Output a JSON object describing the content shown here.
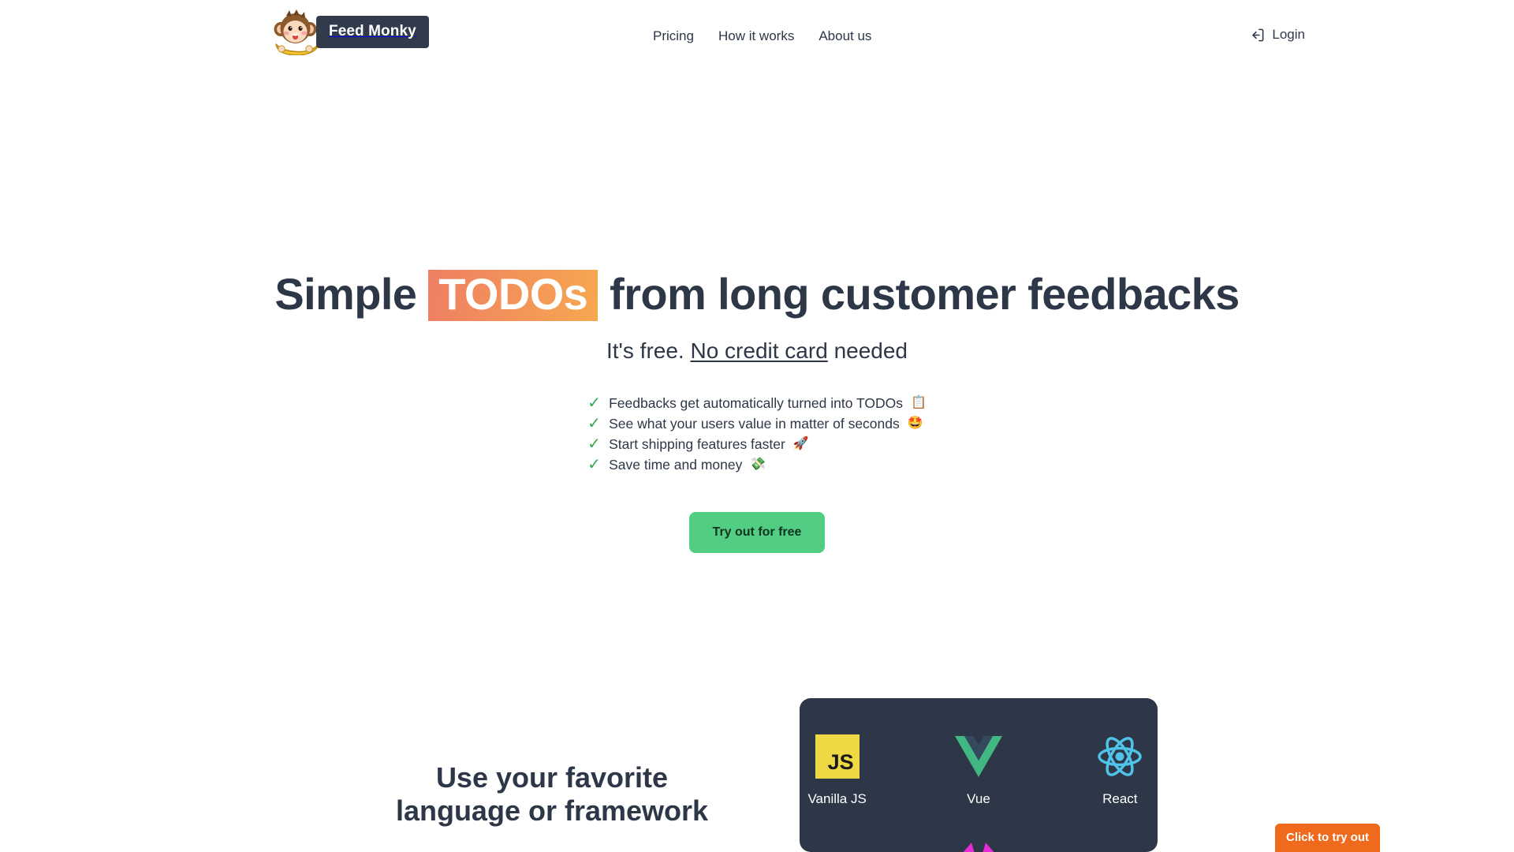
{
  "brand": {
    "logo_icon": "monkey-with-banana-logo",
    "name": "Feed Monky"
  },
  "nav": {
    "items": [
      {
        "label": "Pricing"
      },
      {
        "label": "How it works"
      },
      {
        "label": "About us"
      }
    ],
    "login": {
      "label": "Login",
      "icon": "login-icon"
    }
  },
  "hero": {
    "title_part1": "Simple",
    "title_highlight": "TODOs",
    "title_part2": "from long customer feedbacks",
    "highlight_gradient_from": "#ef7e63",
    "highlight_gradient_to": "#f6a850",
    "subtitle_part1": "It's free.",
    "subtitle_underlined": "No credit card",
    "subtitle_part2": "needed",
    "features": [
      {
        "check": "✓",
        "text": "Feedbacks get automatically turned into TODOs",
        "emoji": "📋"
      },
      {
        "check": "✓",
        "text": "See what your users value in matter of seconds",
        "emoji": "🤩"
      },
      {
        "check": "✓",
        "text": "Start shipping features faster",
        "emoji": "🚀"
      },
      {
        "check": "✓",
        "text": "Save time and money",
        "emoji": "💸"
      }
    ],
    "cta_label": "Try out for free",
    "cta_color": "#52ce84",
    "check_color": "#34a853"
  },
  "section2": {
    "heading_line1": "Use your favorite",
    "heading_line2": "language or framework",
    "card_background": "#2d3748",
    "frameworks": [
      {
        "label": "Vanilla JS",
        "icon": "javascript-logo-icon",
        "color": "#eed945"
      },
      {
        "label": "Vue",
        "icon": "vue-logo-icon",
        "color": "#41b883"
      },
      {
        "label": "React",
        "icon": "react-logo-icon",
        "color": "#4fc3e8"
      }
    ]
  },
  "floating": {
    "try_badge_label": "Click to try out",
    "try_badge_color": "#f06a1e"
  }
}
